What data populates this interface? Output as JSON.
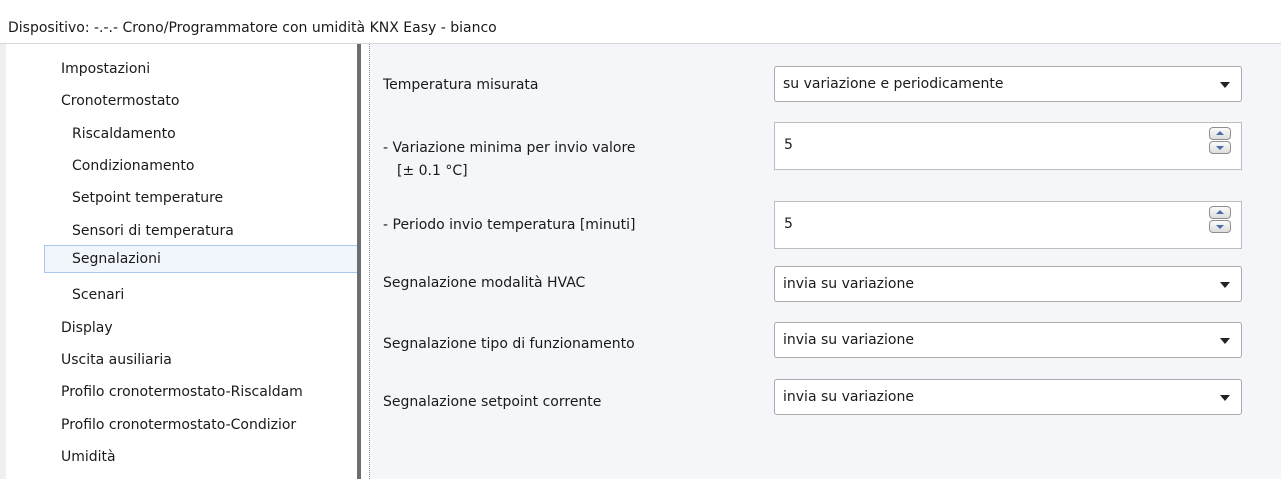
{
  "window": {
    "title": "Dispositivo: -.-.-  Crono/Programmatore con umidità KNX Easy - bianco"
  },
  "tree": {
    "items": [
      {
        "label": "Impostazioni"
      },
      {
        "label": "Cronotermostato"
      },
      {
        "label": "Riscaldamento"
      },
      {
        "label": "Condizionamento"
      },
      {
        "label": "Setpoint temperature"
      },
      {
        "label": "Sensori di temperatura"
      },
      {
        "label": "Segnalazioni"
      },
      {
        "label": "Scenari"
      },
      {
        "label": "Display"
      },
      {
        "label": "Uscita ausiliaria"
      },
      {
        "label": "Profilo cronotermostato-Riscaldam"
      },
      {
        "label": "Profilo cronotermostato-Condizior"
      },
      {
        "label": "Umidità"
      }
    ],
    "selected": "Segnalazioni"
  },
  "params": {
    "temp_measured": {
      "label": "Temperatura misurata",
      "value": "su variazione e periodicamente"
    },
    "min_variation": {
      "label_line1": "- Variazione minima per invio valore",
      "label_line2": "[± 0.1 °C]",
      "value": "5"
    },
    "period": {
      "label": "- Periodo invio temperatura [minuti]",
      "value": "5"
    },
    "hvac_mode": {
      "label": "Segnalazione modalità HVAC",
      "value": "invia su variazione"
    },
    "operation_type": {
      "label": "Segnalazione tipo di funzionamento",
      "value": "invia su variazione"
    },
    "current_setpoint": {
      "label": "Segnalazione setpoint corrente",
      "value": "invia su variazione"
    }
  }
}
